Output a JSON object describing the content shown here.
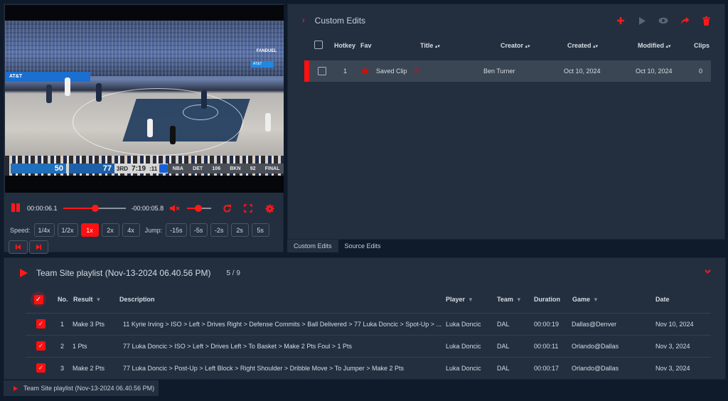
{
  "player": {
    "scoreboard": {
      "team1_score": "50",
      "team2_score": "77",
      "period": "3RD",
      "clock": "7:19",
      "shot_clock": ":11",
      "league": "NBA",
      "other_game": {
        "team1": "DET",
        "team1_score": "106",
        "team2": "BKN",
        "team2_score": "92",
        "status": "FINAL"
      }
    },
    "overlay": {
      "sponsor": "FANDUEL",
      "ad": "AT&T"
    },
    "current_time": "00:00:06.1",
    "remaining_time": "-00:00:05.8",
    "progress": 0.52,
    "volume": 0.48,
    "speed_label": "Speed:",
    "speed_options": [
      "1/4x",
      "1/2x",
      "1x",
      "2x",
      "4x"
    ],
    "speed_selected": "1x",
    "jump_label": "Jump:",
    "jump_options": [
      "-15s",
      "-5s",
      "-2s",
      "2s",
      "5s"
    ],
    "icons": {
      "pause": "pause-icon",
      "mute": "volume-mute-icon",
      "replay": "replay-icon",
      "fullscreen": "fullscreen-icon",
      "settings": "gear-icon",
      "prev": "skip-previous-icon",
      "next": "skip-next-icon"
    }
  },
  "edits": {
    "title": "Custom Edits",
    "actions": [
      "add-icon",
      "play-icon",
      "eye-icon",
      "share-icon",
      "trash-icon"
    ],
    "columns": {
      "hotkey": "Hotkey",
      "fav": "Fav",
      "title": "Title",
      "creator": "Creator",
      "created": "Created",
      "modified": "Modified",
      "clips": "Clips"
    },
    "rows": [
      {
        "hotkey": "1",
        "title": "Saved Clip",
        "creator": "Ben Turner",
        "created": "Oct 10, 2024",
        "modified": "Oct 10, 2024",
        "clips": "0"
      }
    ],
    "tabs": [
      "Custom Edits",
      "Source Edits"
    ],
    "active_tab": "Custom Edits"
  },
  "playlist": {
    "title": "Team Site playlist (Nov-13-2024 06.40.56 PM)",
    "count": "5 / 9",
    "columns": {
      "no": "No.",
      "result": "Result",
      "description": "Description",
      "player": "Player",
      "team": "Team",
      "duration": "Duration",
      "game": "Game",
      "date": "Date"
    },
    "rows": [
      {
        "no": "1",
        "result": "Make 3 Pts",
        "description": "11 Kyrie Irving > ISO > Left > Drives Right > Defense Commits > Ball Delivered > 77 Luka Doncic > Spot-Up > ...",
        "player": "Luka Doncic",
        "team": "DAL",
        "duration": "00:00:19",
        "game": "Dallas@Denver",
        "date": "Nov 10, 2024",
        "checked": true
      },
      {
        "no": "2",
        "result": "1 Pts",
        "description": "77 Luka Doncic > ISO > Left > Drives Left > To Basket > Make 2 Pts Foul > 1 Pts",
        "player": "Luka Doncic",
        "team": "DAL",
        "duration": "00:00:11",
        "game": "Orlando@Dallas",
        "date": "Nov 3, 2024",
        "checked": true
      },
      {
        "no": "3",
        "result": "Make 2 Pts",
        "description": "77 Luka Doncic > Post-Up > Left Block > Right Shoulder > Dribble Move > To Jumper > Make 2 Pts",
        "player": "Luka Doncic",
        "team": "DAL",
        "duration": "00:00:17",
        "game": "Orlando@Dallas",
        "date": "Nov 3, 2024",
        "checked": true
      }
    ]
  },
  "status_tab": {
    "label": "Team Site playlist (Nov-13-2024 06.40.56 PM)"
  },
  "colors": {
    "accent": "#ff1010",
    "panel": "#232f3f",
    "background": "#0f1a2a"
  }
}
